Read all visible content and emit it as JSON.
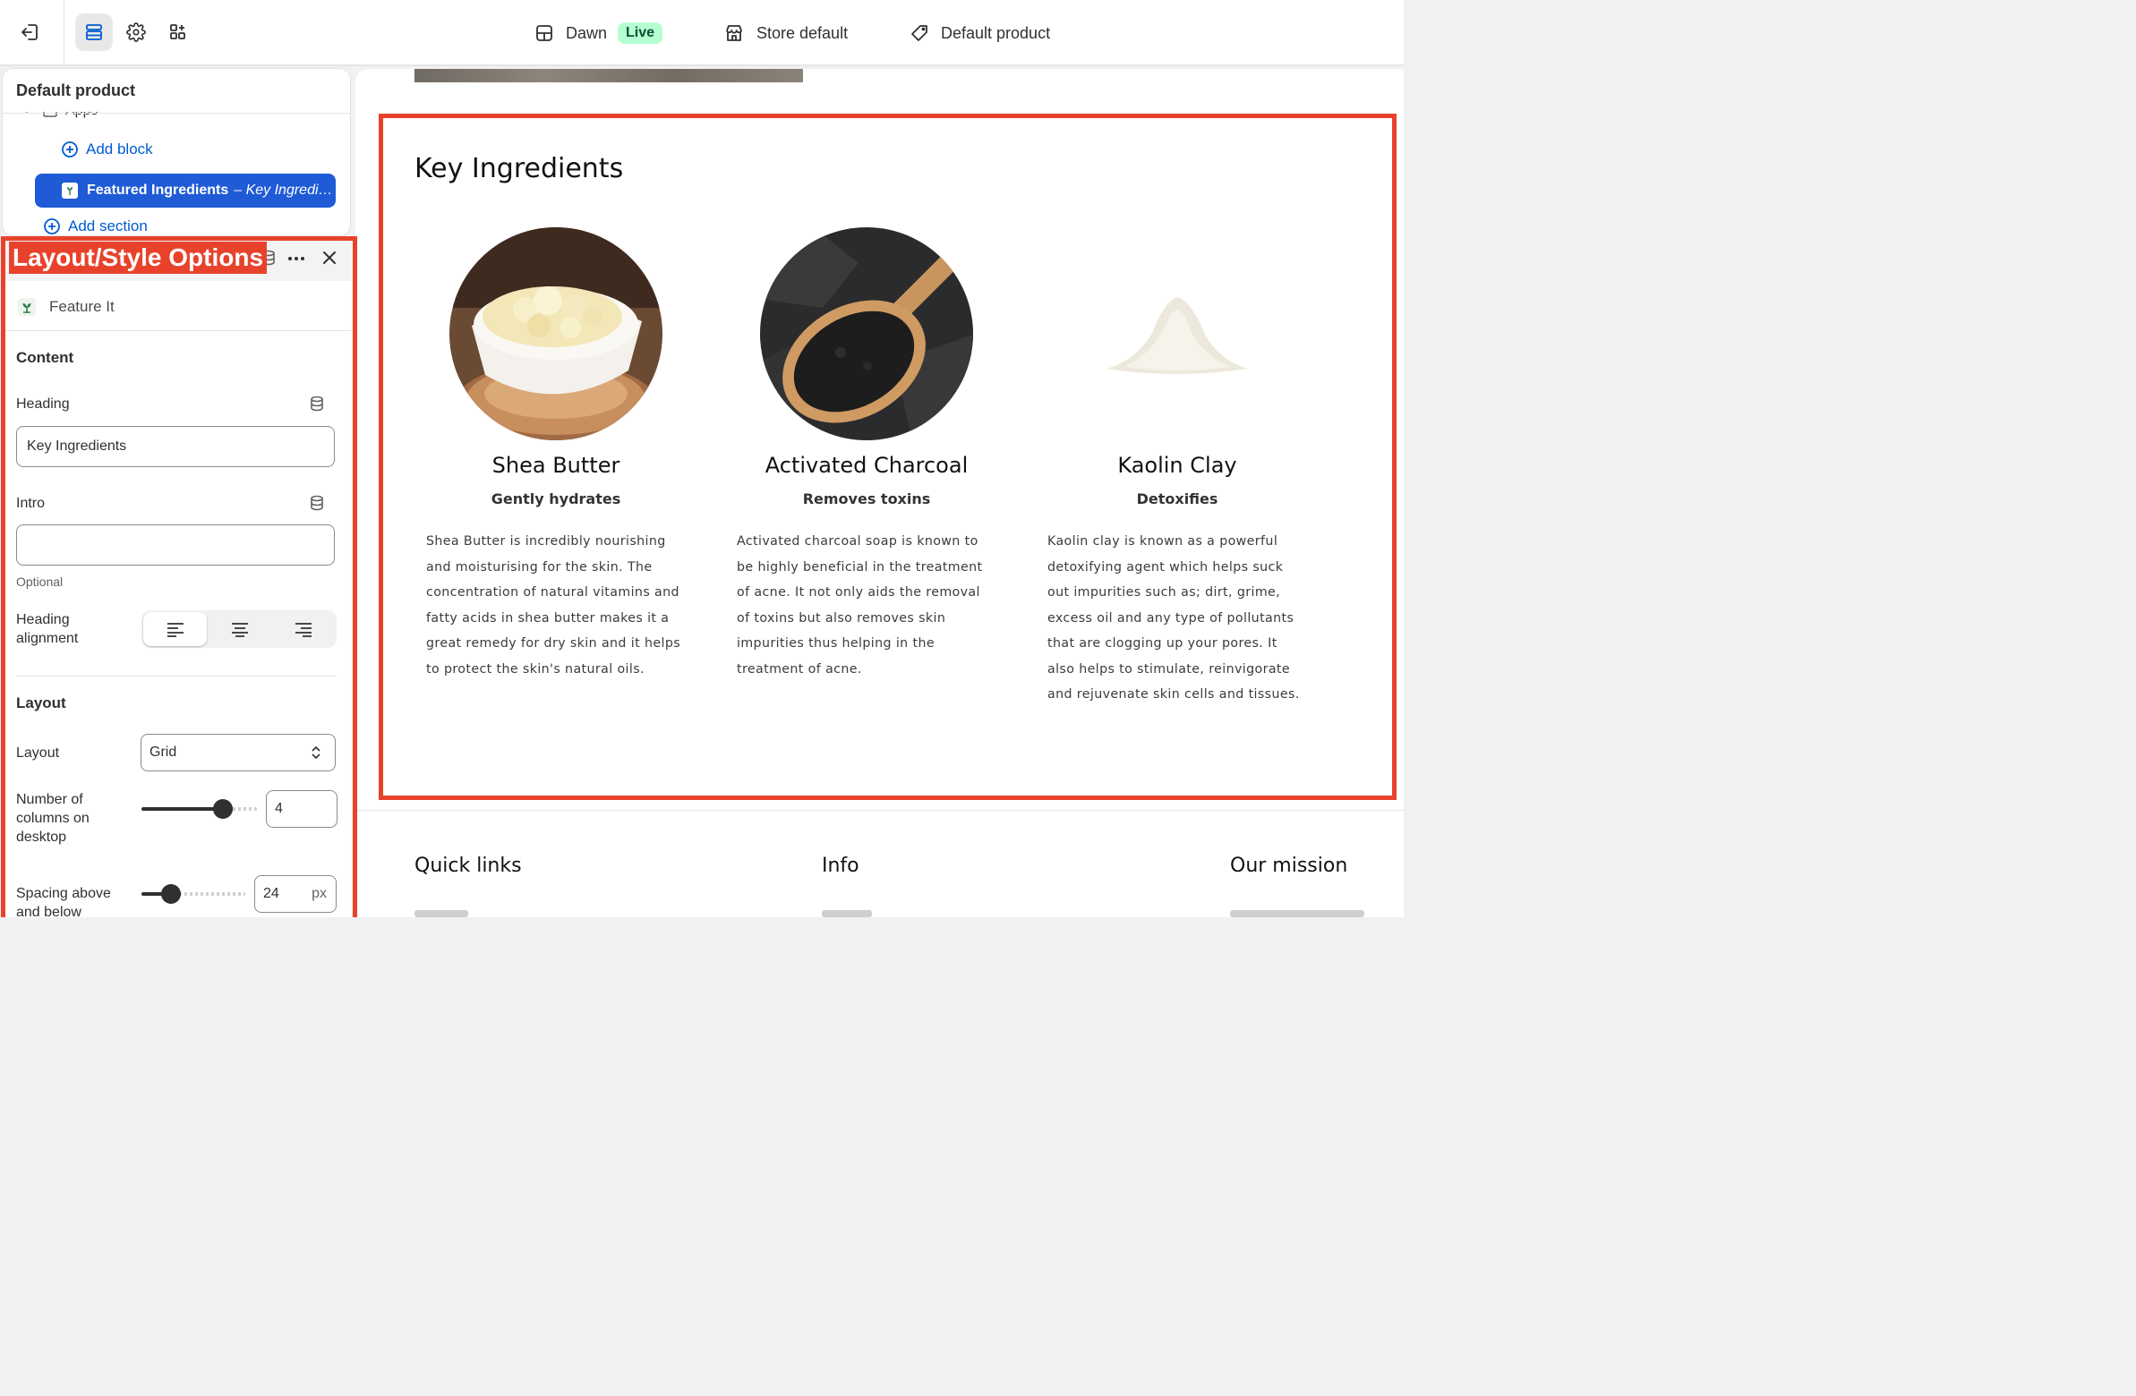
{
  "topbar": {
    "theme_name": "Dawn",
    "theme_status": "Live",
    "store_label": "Store default",
    "template_label": "Default product"
  },
  "tree": {
    "title": "Default product",
    "apps_label": "Apps",
    "add_block": "Add block",
    "selected_name": "Featured Ingredients",
    "selected_sub": "– Key Ingredi…",
    "add_section": "Add section"
  },
  "annotation": {
    "label": "Layout/Style Options",
    "color": "#e8422c"
  },
  "settings": {
    "app_name": "Feature It",
    "content_title": "Content",
    "heading_label": "Heading",
    "heading_value": "Key Ingredients",
    "intro_label": "Intro",
    "intro_value": "",
    "intro_help": "Optional",
    "heading_alignment_label": "Heading alignment",
    "heading_alignment_value": "left",
    "layout_title": "Layout",
    "layout_label": "Layout",
    "layout_value": "Grid",
    "columns_label": "Number of columns on desktop",
    "columns_value": "4",
    "spacing_label": "Spacing above and below",
    "spacing_value": "24",
    "spacing_unit": "px"
  },
  "preview": {
    "heading": "Key Ingredients",
    "cards": [
      {
        "title": "Shea Butter",
        "subtitle": "Gently hydrates",
        "body": "Shea Butter is incredibly nourishing and moisturising for the skin. The concentration of natural vitamins and fatty acids in shea butter makes it a great remedy for dry skin and it helps to protect the skin's natural oils."
      },
      {
        "title": "Activated Charcoal",
        "subtitle": "Removes toxins",
        "body": "Activated charcoal soap is known to be highly beneficial in the treatment of acne. It not only aids the removal of toxins but also removes skin impurities thus helping in the treatment of acne."
      },
      {
        "title": "Kaolin Clay",
        "subtitle": "Detoxifies",
        "body": "Kaolin clay is known as a powerful detoxifying agent which helps suck out impurities such as; dirt, grime, excess oil and any type of pollutants that are clogging up your pores. It also helps to stimulate, reinvigorate and rejuvenate skin cells and tissues."
      }
    ],
    "footer": [
      "Quick links",
      "Info",
      "Our mission"
    ]
  },
  "colors": {
    "accent": "#005bd3",
    "selected": "#1f5bd6",
    "live_bg": "#b4fed2",
    "live_text": "#0c5132",
    "annotation": "#e8422c"
  }
}
